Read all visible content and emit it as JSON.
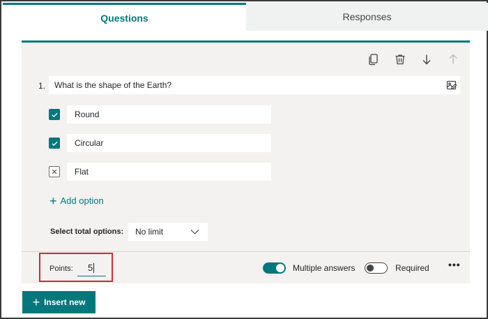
{
  "tabs": [
    {
      "label": "Questions",
      "active": true
    },
    {
      "label": "Responses",
      "active": false
    }
  ],
  "toolbar": {
    "icons": [
      "copy-icon",
      "delete-icon",
      "move-down-icon",
      "move-up-icon"
    ]
  },
  "question": {
    "number": "1.",
    "text": "What is the shape of the Earth?",
    "options": [
      {
        "label": "Round",
        "state": "checked"
      },
      {
        "label": "Circular",
        "state": "checked"
      },
      {
        "label": "Flat",
        "state": "unchecked"
      }
    ],
    "add_option_label": "Add option",
    "select_total_label": "Select total options:",
    "select_total_value": "No limit"
  },
  "footer": {
    "points_label": "Points:",
    "points_value": "5",
    "multiple_answers_label": "Multiple answers",
    "multiple_answers_on": true,
    "required_label": "Required",
    "required_on": false,
    "more_label": "•••"
  },
  "insert_new_label": "Insert new",
  "colors": {
    "accent": "#03787c",
    "highlight": "#d9262e",
    "card_bg": "#f3f2f1"
  }
}
